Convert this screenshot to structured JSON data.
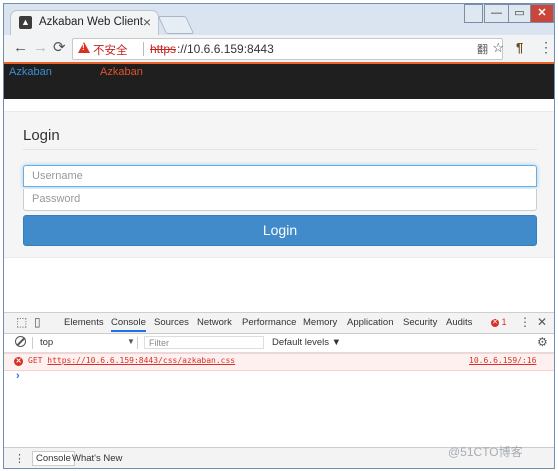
{
  "browser": {
    "tab_title": "Azkaban Web Client",
    "tab_close": "×",
    "window_controls": {
      "user": "👤",
      "minimize": "—",
      "maximize": "▭",
      "close": "✕"
    },
    "nav": {
      "back": "←",
      "forward": "→",
      "reload": "C"
    },
    "address": {
      "security_label": "不安全",
      "scheme": "https",
      "url_rest": "://10.6.6.159:8443"
    },
    "icons": {
      "translate": "翻",
      "star": "☆",
      "extension": "¶",
      "menu": "⋮"
    }
  },
  "page": {
    "navbar": {
      "link1": "Azkaban",
      "link2": "Azkaban"
    },
    "login": {
      "title": "Login",
      "username_placeholder": "Username",
      "password_placeholder": "Password",
      "button_label": "Login"
    },
    "colors": {
      "navbar_bg": "#1f1f1f",
      "accent_stripe": "#e8622a",
      "login_button": "#428bca"
    }
  },
  "devtools": {
    "tabs": [
      "Elements",
      "Console",
      "Sources",
      "Network",
      "Performance",
      "Memory",
      "Application",
      "Security",
      "Audits"
    ],
    "active_tab": "Console",
    "error_count": "1",
    "context": "top",
    "filter_placeholder": "Filter",
    "levels": "Default levels ▼",
    "console": {
      "error_method": "GET",
      "error_url": "https://10.6.6.159:8443/css/azkaban.css",
      "error_source": "10.6.6.159/:16",
      "prompt": "›"
    },
    "drawer": {
      "tab1": "Console",
      "tab2": "What's New",
      "close": "×"
    }
  },
  "watermark": "@51CTO博客"
}
